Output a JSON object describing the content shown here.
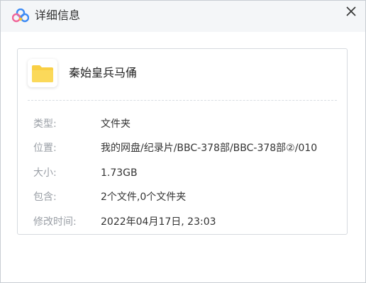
{
  "window": {
    "title": "详细信息",
    "logo_icon": "cloud-logo-icon",
    "close_icon": "close-icon"
  },
  "file": {
    "icon": "folder-icon",
    "name": "秦始皇兵马俑"
  },
  "details": [
    {
      "label": "类型:",
      "value": "文件夹"
    },
    {
      "label": "位置:",
      "value": "我的网盘/纪录片/BBC-378部/BBC-378部②/010"
    },
    {
      "label": "大小:",
      "value": "1.73GB"
    },
    {
      "label": "包含:",
      "value": "2个文件,0个文件夹"
    },
    {
      "label": "修改时间:",
      "value": "2022年04月17日, 23:03"
    }
  ],
  "colors": {
    "logo_blue": "#3d8bf5",
    "logo_pink": "#f0669a",
    "logo_yellow": "#f7c12c",
    "folder_yellow": "#f9cf44"
  }
}
